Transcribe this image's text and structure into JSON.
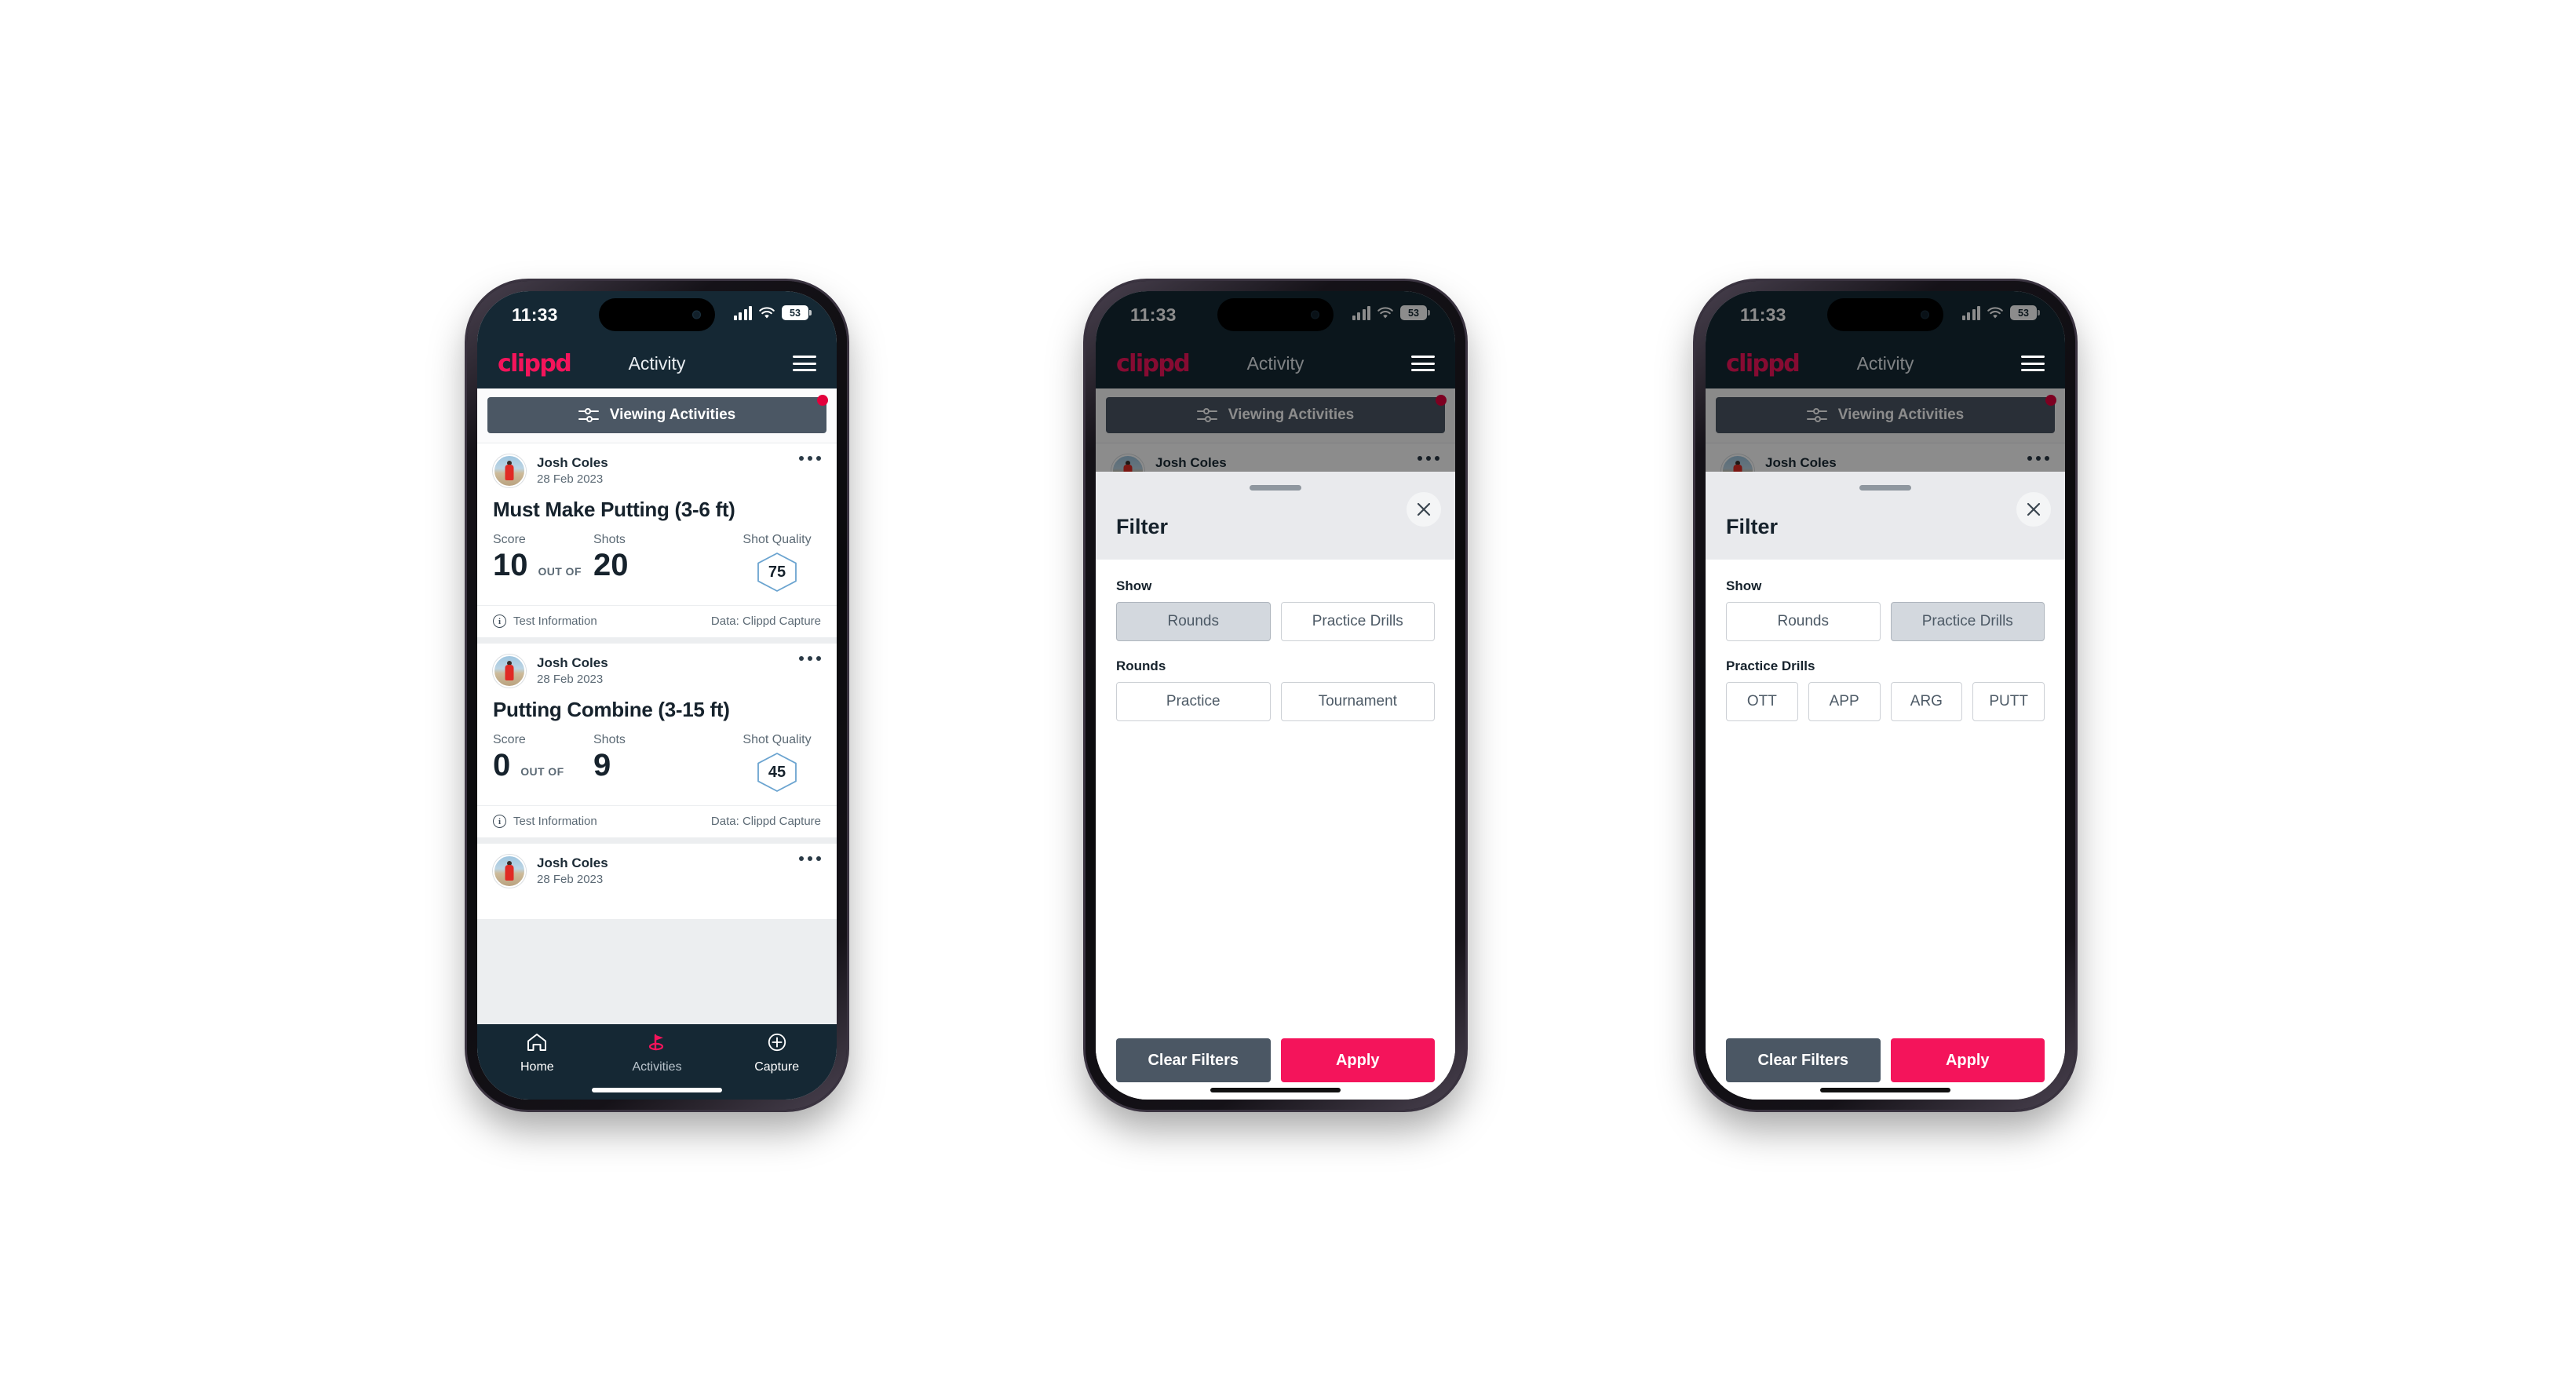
{
  "statusbar": {
    "time": "11:33",
    "battery": "53"
  },
  "appbar": {
    "logo": "clippd",
    "title": "Activity"
  },
  "filterbar": {
    "label": "Viewing Activities"
  },
  "feed": {
    "cards": [
      {
        "user": "Josh Coles",
        "date": "28 Feb 2023",
        "title": "Must Make Putting (3-6 ft)",
        "score_label": "Score",
        "score_value": "10",
        "out_of": "OUT OF",
        "shots_label": "Shots",
        "shots_value": "20",
        "quality_label": "Shot Quality",
        "quality_value": "75",
        "foot_left": "Test Information",
        "foot_right": "Data: Clippd Capture"
      },
      {
        "user": "Josh Coles",
        "date": "28 Feb 2023",
        "title": "Putting Combine (3-15 ft)",
        "score_label": "Score",
        "score_value": "0",
        "out_of": "OUT OF",
        "shots_label": "Shots",
        "shots_value": "9",
        "quality_label": "Shot Quality",
        "quality_value": "45",
        "foot_left": "Test Information",
        "foot_right": "Data: Clippd Capture"
      },
      {
        "user": "Josh Coles",
        "date": "28 Feb 2023"
      }
    ]
  },
  "bottomnav": {
    "items": [
      {
        "label": "Home",
        "icon": "home-icon"
      },
      {
        "label": "Activities",
        "icon": "golf-flag-icon"
      },
      {
        "label": "Capture",
        "icon": "plus-circle-icon"
      }
    ]
  },
  "filter_sheet": {
    "title": "Filter",
    "show_label": "Show",
    "show_options": [
      "Rounds",
      "Practice Drills"
    ],
    "rounds_label": "Rounds",
    "rounds_options": [
      "Practice",
      "Tournament"
    ],
    "practice_label": "Practice Drills",
    "practice_options": [
      "OTT",
      "APP",
      "ARG",
      "PUTT"
    ],
    "clear_label": "Clear Filters",
    "apply_label": "Apply"
  },
  "screens": {
    "phone1": {
      "name": "activity-feed"
    },
    "phone2": {
      "name": "filter-rounds-selected",
      "selected_show": "Rounds"
    },
    "phone3": {
      "name": "filter-practice-drills-selected",
      "selected_show": "Practice Drills"
    }
  },
  "colors": {
    "brand_pink": "#f4145b",
    "header_navy": "#152834",
    "slate": "#4b5764",
    "notification_red": "#e3003c",
    "hex_blue": "#6ba4d0"
  }
}
